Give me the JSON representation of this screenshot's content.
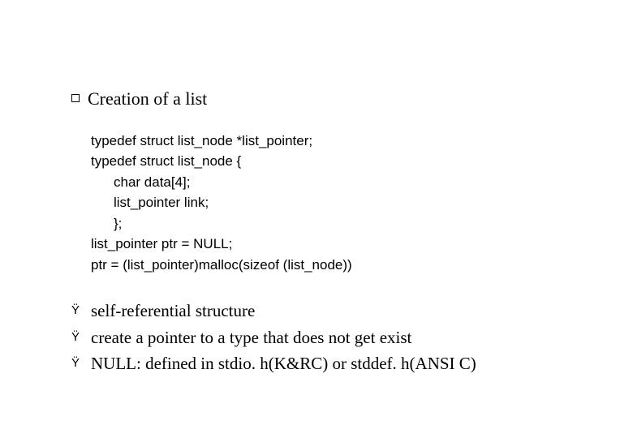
{
  "heading": "Creation of a list",
  "code": {
    "l1": "typedef struct list_node *list_pointer;",
    "l2": "typedef struct list_node {",
    "l3": "char data[4];",
    "l4": "list_pointer link;",
    "l5": "};",
    "l6": "list_pointer ptr = NULL;",
    "l7": "ptr = (list_pointer)malloc(sizeof (list_node))"
  },
  "notes": {
    "bullet": "Ÿ",
    "n1": "self-referential structure",
    "n2": "create a pointer to a type that does not get exist",
    "n3": "NULL: defined in stdio. h(K&RC) or stddef. h(ANSI C)"
  }
}
